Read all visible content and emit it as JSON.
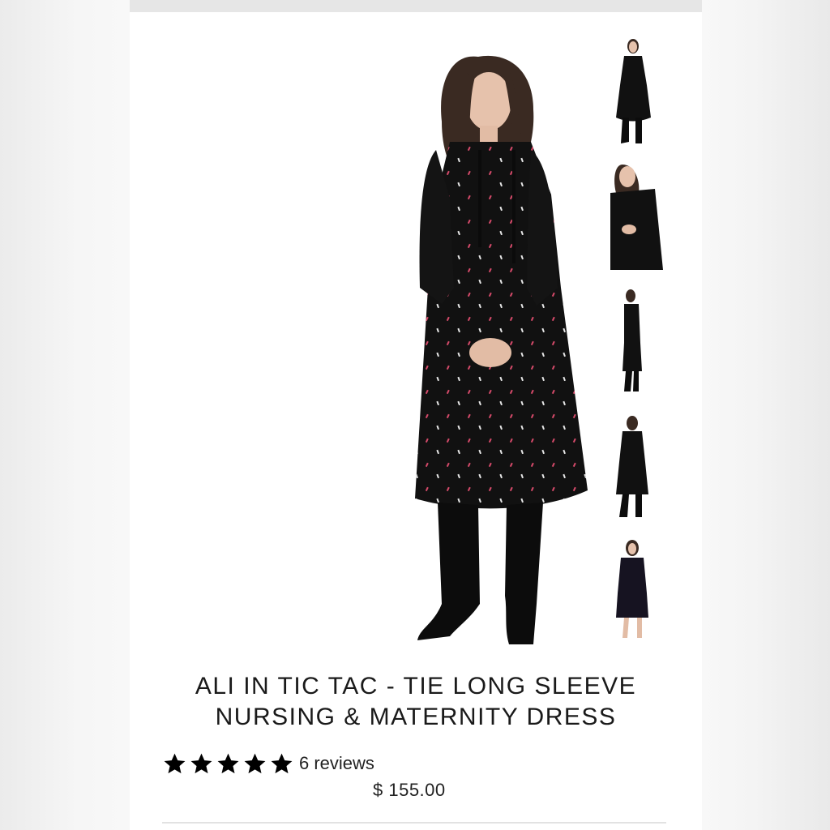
{
  "product": {
    "title_line1": "ALI IN TIC TAC - TIE LONG SLEEVE",
    "title_line2": "NURSING & MATERNITY DRESS",
    "rating_stars": 5,
    "reviews_label": "6 reviews",
    "price": "$ 155.00"
  },
  "gallery": {
    "thumbnail_count": 5
  },
  "colors": {
    "dress": "#111111",
    "star": "#000000",
    "dot_pink": "#d64a6a",
    "dot_white": "#e8e8e8"
  }
}
